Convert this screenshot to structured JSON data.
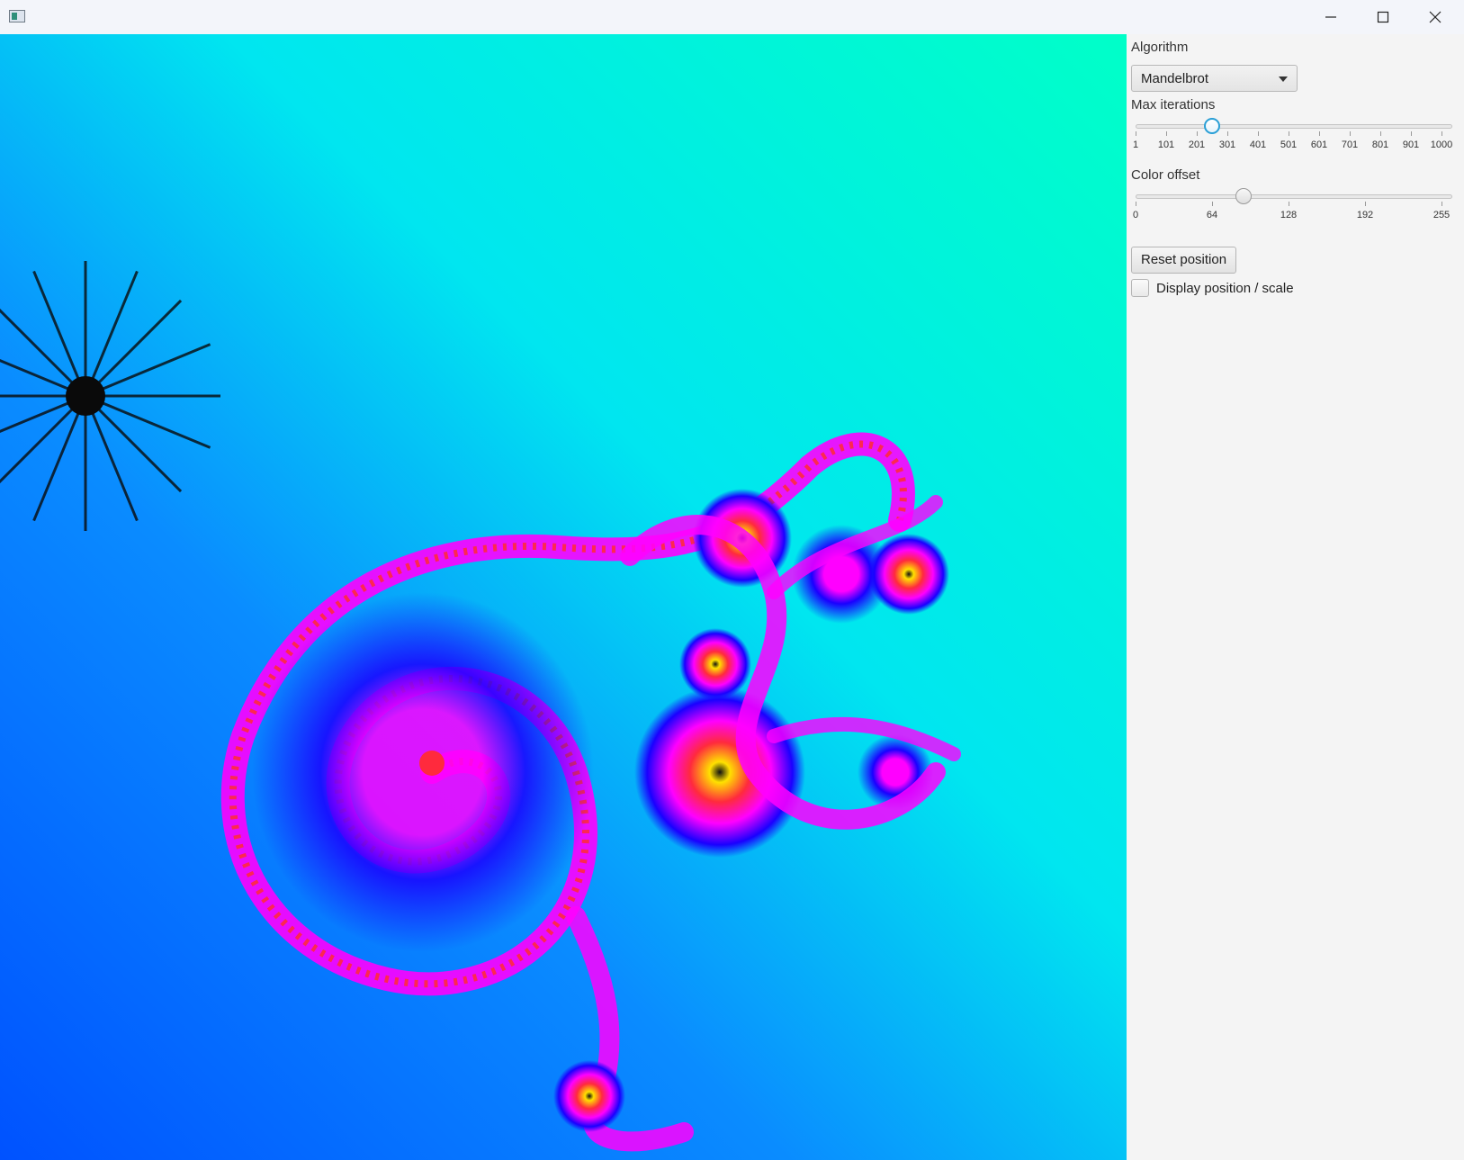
{
  "window": {
    "title": "",
    "controls": {
      "minimize": "minimize-icon",
      "maximize": "maximize-icon",
      "close": "close-icon"
    }
  },
  "panel": {
    "algorithm_label": "Algorithm",
    "algorithm_value": "Mandelbrot",
    "max_iterations": {
      "label": "Max iterations",
      "ticks": [
        "1",
        "101",
        "201",
        "301",
        "401",
        "501",
        "601",
        "701",
        "801",
        "901",
        "1000"
      ],
      "min": 1,
      "max": 1000,
      "value": 250
    },
    "color_offset": {
      "label": "Color offset",
      "ticks": [
        "0",
        "64",
        "128",
        "192",
        "255"
      ],
      "min": 0,
      "max": 255,
      "value": 90
    },
    "reset_label": "Reset position",
    "display_label": "Display position / scale",
    "display_checked": false
  },
  "colors": {
    "fractal_cyan": "#00ffd0",
    "fractal_blue": "#0057ff",
    "fractal_deep": "#1a00ff",
    "fractal_magenta": "#ff00ff",
    "fractal_red": "#ff2a3d",
    "fractal_yellow": "#ffe100",
    "slider_focus": "#2a9fd6"
  }
}
